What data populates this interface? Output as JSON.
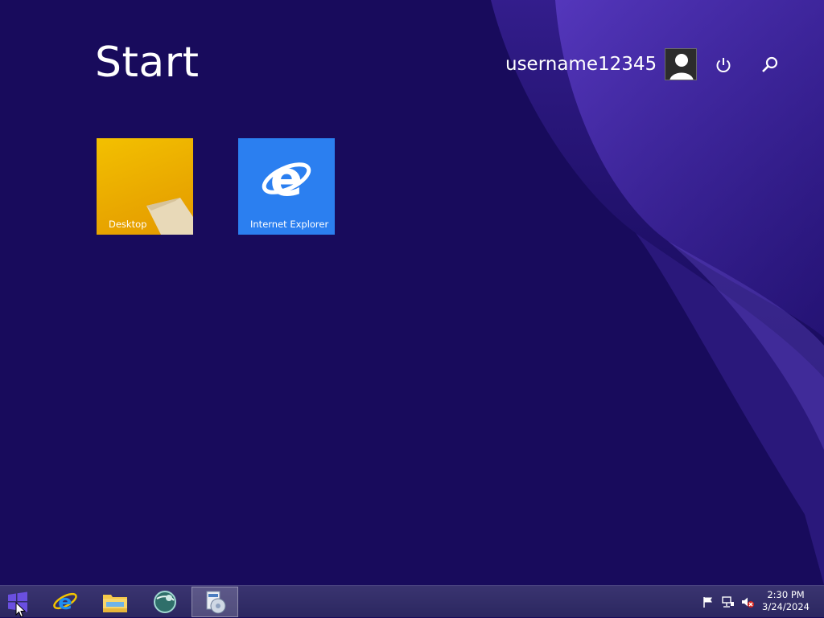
{
  "start": {
    "title": "Start"
  },
  "user": {
    "name": "username12345"
  },
  "tiles": [
    {
      "label": "Desktop",
      "color": "#ebaa00"
    },
    {
      "label": "Internet Explorer",
      "color": "#2b7ff0"
    }
  ],
  "taskbar": {
    "apps": [
      {
        "icon": "windows-logo-icon"
      },
      {
        "icon": "internet-explorer-icon"
      },
      {
        "icon": "file-explorer-icon"
      },
      {
        "icon": "globe-app-icon"
      },
      {
        "icon": "media-app-icon"
      }
    ]
  },
  "tray": {
    "icons": [
      "action-center-flag-icon",
      "network-icon",
      "volume-muted-icon"
    ],
    "time": "2:30 PM",
    "date": "3/24/2024"
  },
  "colors": {
    "background": "#180b5c",
    "accent_swoosh": "#4a2fb0",
    "taskbar": "#2f2a66"
  }
}
